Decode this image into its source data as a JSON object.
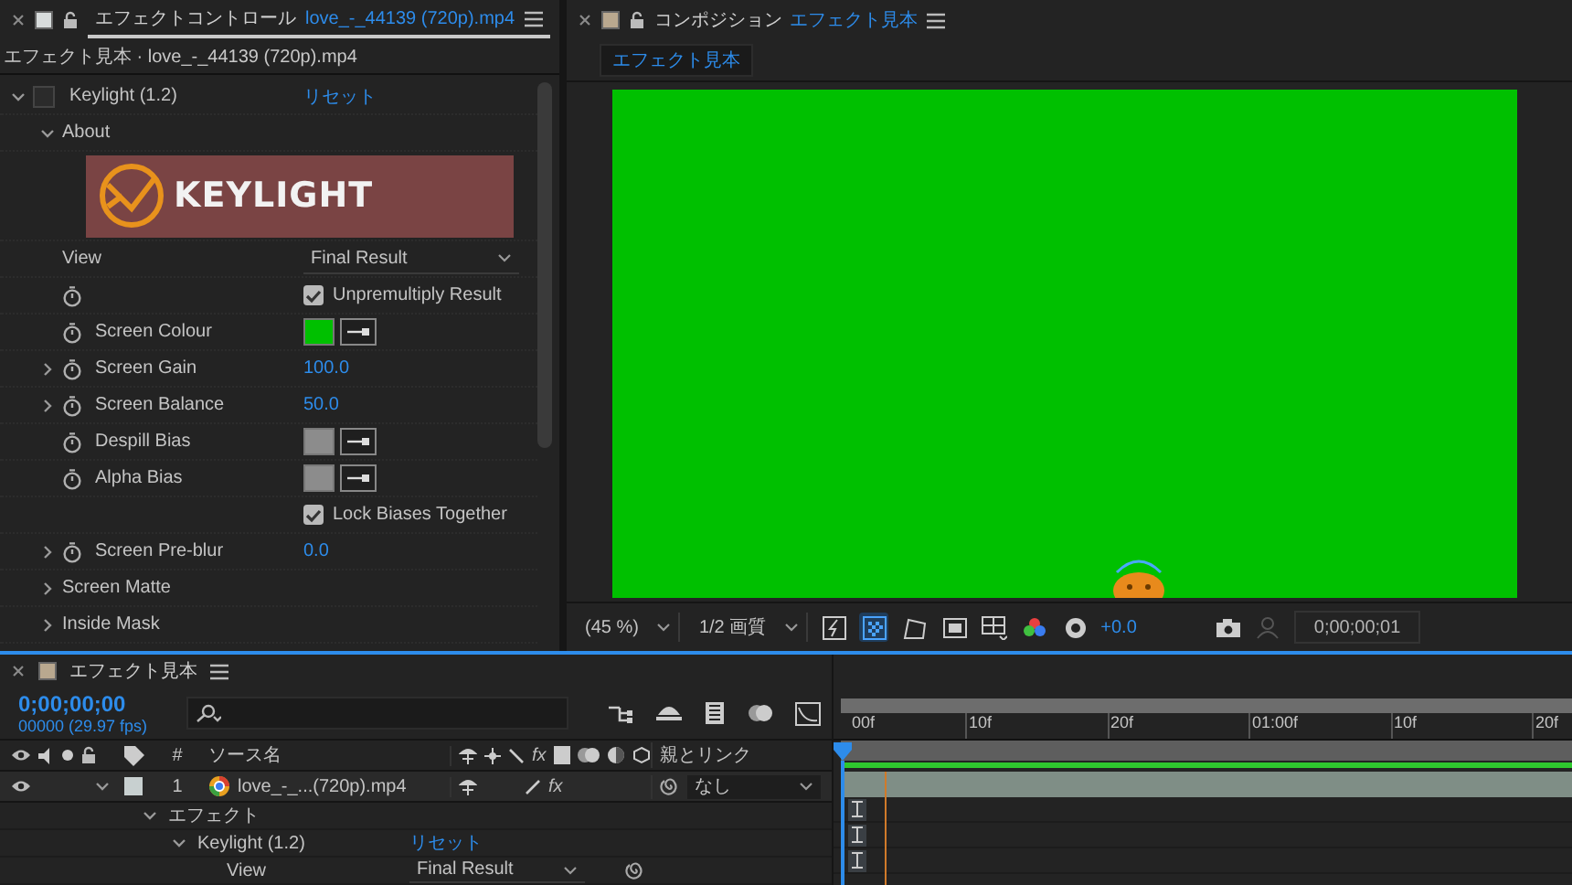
{
  "effect_controls": {
    "tab_title": "エフェクトコントロール",
    "tab_file": "love_-_44139 (720p).mp4",
    "breadcrumb": "エフェクト見本 · love_-_44139 (720p).mp4",
    "effect": {
      "name": "Keylight (1.2)",
      "reset": "リセット",
      "expanded": true
    },
    "rows": [
      {
        "kind": "group",
        "label": "About",
        "expanded": true
      },
      {
        "kind": "banner",
        "title": "KEYLIGHT"
      },
      {
        "kind": "dropdown",
        "label": "View",
        "value": "Final Result"
      },
      {
        "kind": "checkbox",
        "stopwatch": true,
        "text": "Unpremultiply Result",
        "checked": true
      },
      {
        "kind": "color",
        "label": "Screen Colour",
        "stopwatch": true,
        "color": "#00c000"
      },
      {
        "kind": "number",
        "label": "Screen Gain",
        "stopwatch": true,
        "expanded": false,
        "value": "100.0"
      },
      {
        "kind": "number",
        "label": "Screen Balance",
        "stopwatch": true,
        "expanded": false,
        "value": "50.0"
      },
      {
        "kind": "color",
        "label": "Despill Bias",
        "stopwatch": true,
        "color": "#8c8c8c"
      },
      {
        "kind": "color",
        "label": "Alpha Bias",
        "stopwatch": true,
        "color": "#8c8c8c"
      },
      {
        "kind": "checkbox",
        "stopwatch": false,
        "text": "Lock Biases Together",
        "checked": true
      },
      {
        "kind": "number",
        "label": "Screen Pre-blur",
        "stopwatch": true,
        "expanded": false,
        "value": "0.0"
      },
      {
        "kind": "group",
        "label": "Screen Matte",
        "expanded": false
      },
      {
        "kind": "group",
        "label": "Inside Mask",
        "expanded": false
      }
    ]
  },
  "composition": {
    "tab_title": "コンポジション",
    "comp_name": "エフェクト見本",
    "chip": "エフェクト見本",
    "toolbar": {
      "zoom": "(45 %)",
      "resolution": "1/2 画質",
      "exposure": "+0.0",
      "timecode": "0;00;00;01"
    }
  },
  "timeline": {
    "tab_title": "エフェクト見本",
    "timecode": "0;00;00;00",
    "frames": "00000 (29.97 fps)",
    "columns": {
      "number": "#",
      "source": "ソース名",
      "fx": "fx",
      "parent": "親とリンク"
    },
    "ruler": [
      "00f",
      "10f",
      "20f",
      "01:00f",
      "10f",
      "20f"
    ],
    "layers": [
      {
        "number": "1",
        "name": "love_-_...(720p).mp4",
        "fx": "fx",
        "effects_on": true,
        "parent": "なし",
        "visible": true,
        "expanded": true
      }
    ],
    "sub_rows": [
      {
        "kind": "group",
        "label": "エフェクト",
        "expanded": true
      },
      {
        "kind": "effect",
        "label": "Keylight (1.2)",
        "reset": "リセット",
        "expanded": true
      },
      {
        "kind": "property",
        "label": "View",
        "value": "Final Result"
      }
    ]
  }
}
